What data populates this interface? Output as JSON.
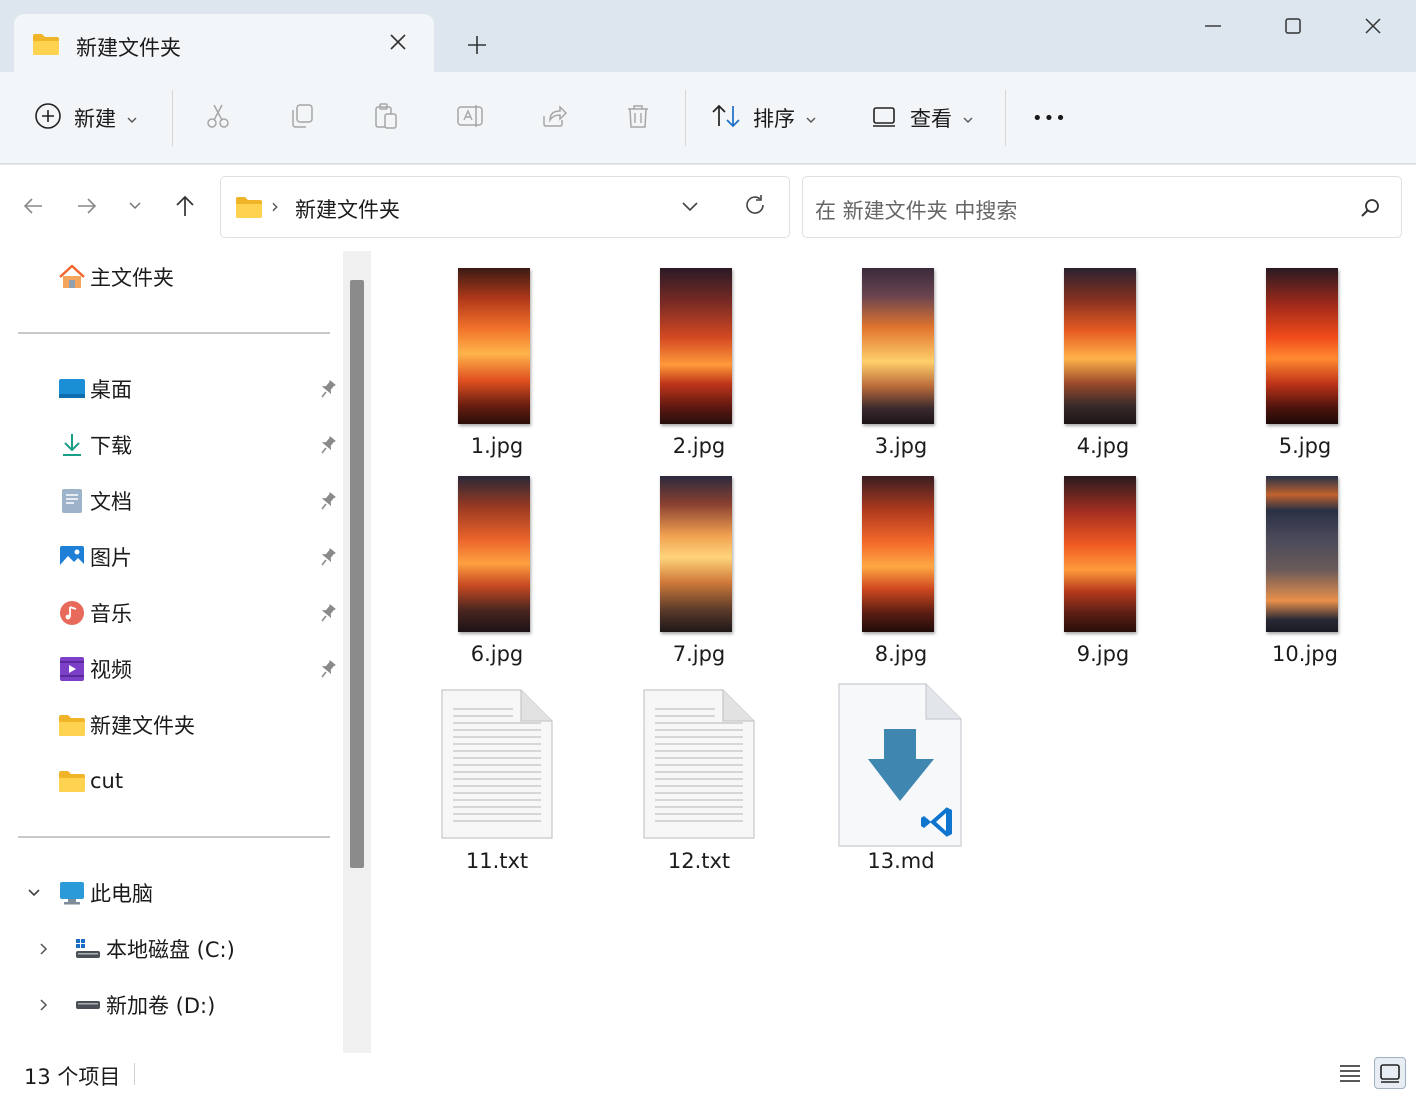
{
  "tab": {
    "title": "新建文件夹",
    "close_icon": "close-icon",
    "new_tab_icon": "plus-icon"
  },
  "window": {
    "minimize": "minimize-icon",
    "maximize": "maximize-icon",
    "close": "close-icon"
  },
  "commandbar": {
    "new_label": "新建",
    "sort_label": "排序",
    "view_label": "查看",
    "more_label": "•••"
  },
  "address": {
    "separator": "›",
    "path": "新建文件夹"
  },
  "search": {
    "placeholder": "在 新建文件夹 中搜索"
  },
  "sidebar": {
    "home": "主文件夹",
    "quick": [
      {
        "label": "桌面",
        "icon": "desktop-icon",
        "pinned": true
      },
      {
        "label": "下载",
        "icon": "download-icon",
        "pinned": true
      },
      {
        "label": "文档",
        "icon": "documents-icon",
        "pinned": true
      },
      {
        "label": "图片",
        "icon": "pictures-icon",
        "pinned": true
      },
      {
        "label": "音乐",
        "icon": "music-icon",
        "pinned": true
      },
      {
        "label": "视频",
        "icon": "videos-icon",
        "pinned": true
      },
      {
        "label": "新建文件夹",
        "icon": "folder-icon",
        "pinned": false
      },
      {
        "label": "cut",
        "icon": "folder-icon",
        "pinned": false
      }
    ],
    "this_pc": "此电脑",
    "drives": [
      {
        "label": "本地磁盘 (C:)",
        "icon": "system-drive-icon"
      },
      {
        "label": "新加卷 (D:)",
        "icon": "drive-icon"
      }
    ]
  },
  "files": [
    {
      "name": "1.jpg",
      "type": "image"
    },
    {
      "name": "2.jpg",
      "type": "image"
    },
    {
      "name": "3.jpg",
      "type": "image"
    },
    {
      "name": "4.jpg",
      "type": "image"
    },
    {
      "name": "5.jpg",
      "type": "image"
    },
    {
      "name": "6.jpg",
      "type": "image"
    },
    {
      "name": "7.jpg",
      "type": "image"
    },
    {
      "name": "8.jpg",
      "type": "image"
    },
    {
      "name": "9.jpg",
      "type": "image"
    },
    {
      "name": "10.jpg",
      "type": "image"
    },
    {
      "name": "11.txt",
      "type": "text"
    },
    {
      "name": "12.txt",
      "type": "text"
    },
    {
      "name": "13.md",
      "type": "markdown"
    }
  ],
  "status": {
    "count_text": "13 个项目"
  },
  "colors": {
    "accent": "#1c6ec4",
    "folder": "#f5c242",
    "fire": "#f25a1a",
    "md_arrow": "#3f86b0",
    "vscode": "#0f75cf"
  }
}
